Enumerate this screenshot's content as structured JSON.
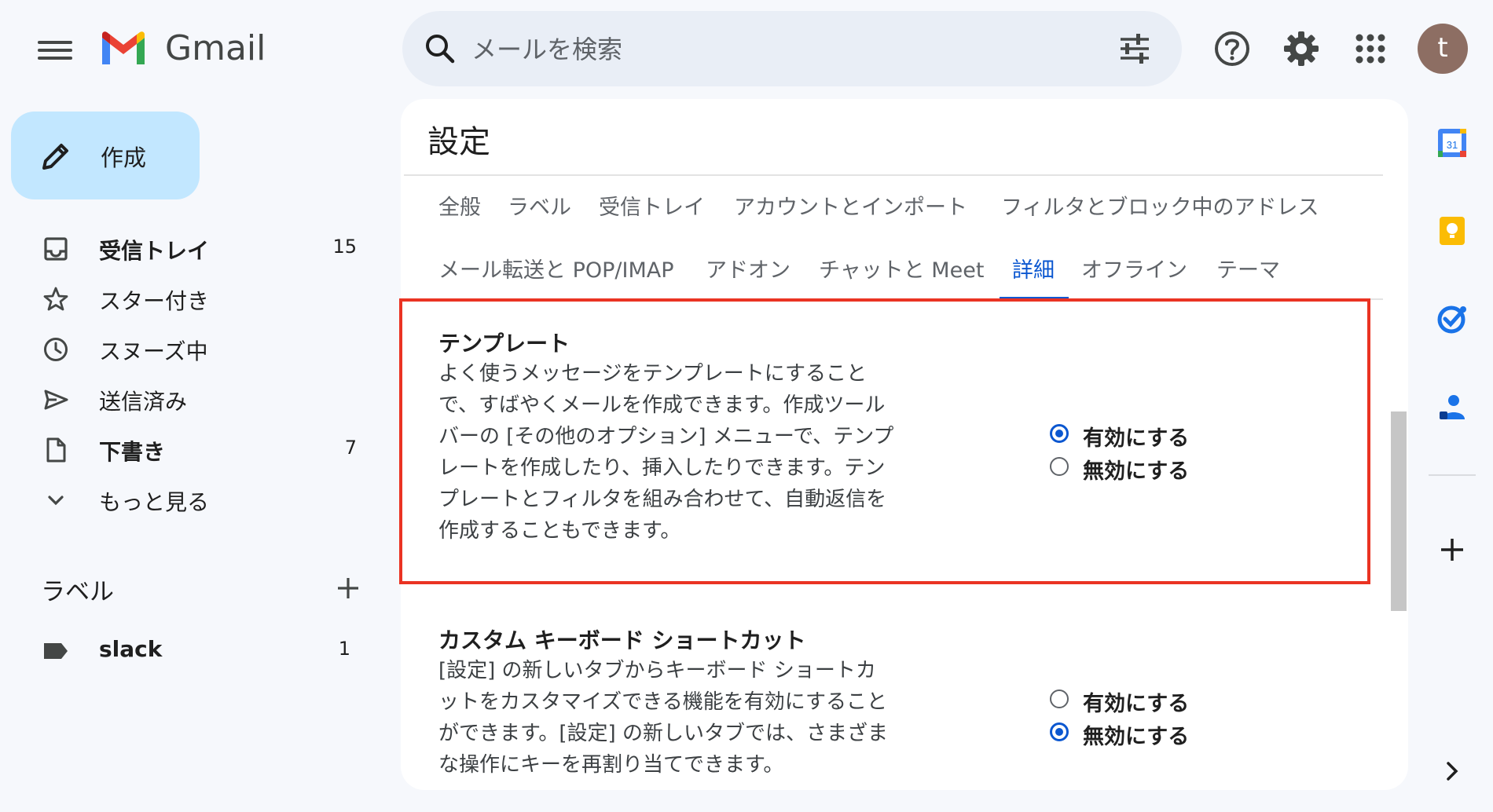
{
  "app": {
    "name": "Gmail"
  },
  "search": {
    "placeholder": "メールを検索"
  },
  "user": {
    "avatar_initial": "t"
  },
  "colors": {
    "accent": "#0b57d0",
    "compose_bg": "#c2e7ff",
    "highlight": "#ea3323"
  },
  "sidebar": {
    "compose_label": "作成",
    "items": [
      {
        "icon": "inbox-icon",
        "label": "受信トレイ",
        "count": "15",
        "bold": true
      },
      {
        "icon": "star-icon",
        "label": "スター付き",
        "count": "",
        "bold": false
      },
      {
        "icon": "clock-icon",
        "label": "スヌーズ中",
        "count": "",
        "bold": false
      },
      {
        "icon": "send-icon",
        "label": "送信済み",
        "count": "",
        "bold": false
      },
      {
        "icon": "draft-icon",
        "label": "下書き",
        "count": "7",
        "bold": true
      },
      {
        "icon": "chevron-down-icon",
        "label": "もっと見る",
        "count": "",
        "bold": false
      }
    ],
    "labels_heading": "ラベル",
    "labels": [
      {
        "name": "slack",
        "count": "1"
      }
    ]
  },
  "settings": {
    "title": "設定",
    "tabs_row1": [
      "全般",
      "ラベル",
      "受信トレイ",
      "アカウントとインポート",
      "フィルタとブロック中のアドレス"
    ],
    "tabs_row2": [
      "メール転送と POP/IMAP",
      "アドオン",
      "チャットと Meet",
      "詳細",
      "オフライン",
      "テーマ"
    ],
    "active_tab": "詳細",
    "sections": [
      {
        "title": "テンプレート",
        "description_lines": [
          "よく使うメッセージをテンプレートにすること",
          "で、すばやくメールを作成できます。作成ツール",
          "バーの [その他のオプション] メニューで、テンプ",
          "レートを作成したり、挿入したりできます。テン",
          "プレートとフィルタを組み合わせて、自動返信を",
          "作成することもできます。"
        ],
        "option_enable": "有効にする",
        "option_disable": "無効にする",
        "selected": "enable"
      },
      {
        "title": "カスタム キーボード ショートカット",
        "description_lines": [
          "[設定] の新しいタブからキーボード ショートカ",
          "ットをカスタマイズできる機能を有効にすること",
          "ができます。[設定] の新しいタブでは、さまざま",
          "な操作にキーを再割り当てできます。"
        ],
        "option_enable": "有効にする",
        "option_disable": "無効にする",
        "selected": "disable"
      }
    ]
  },
  "rail": {
    "icons": [
      "calendar-icon",
      "keep-icon",
      "tasks-icon",
      "contacts-icon"
    ],
    "calendar_day": "31"
  }
}
